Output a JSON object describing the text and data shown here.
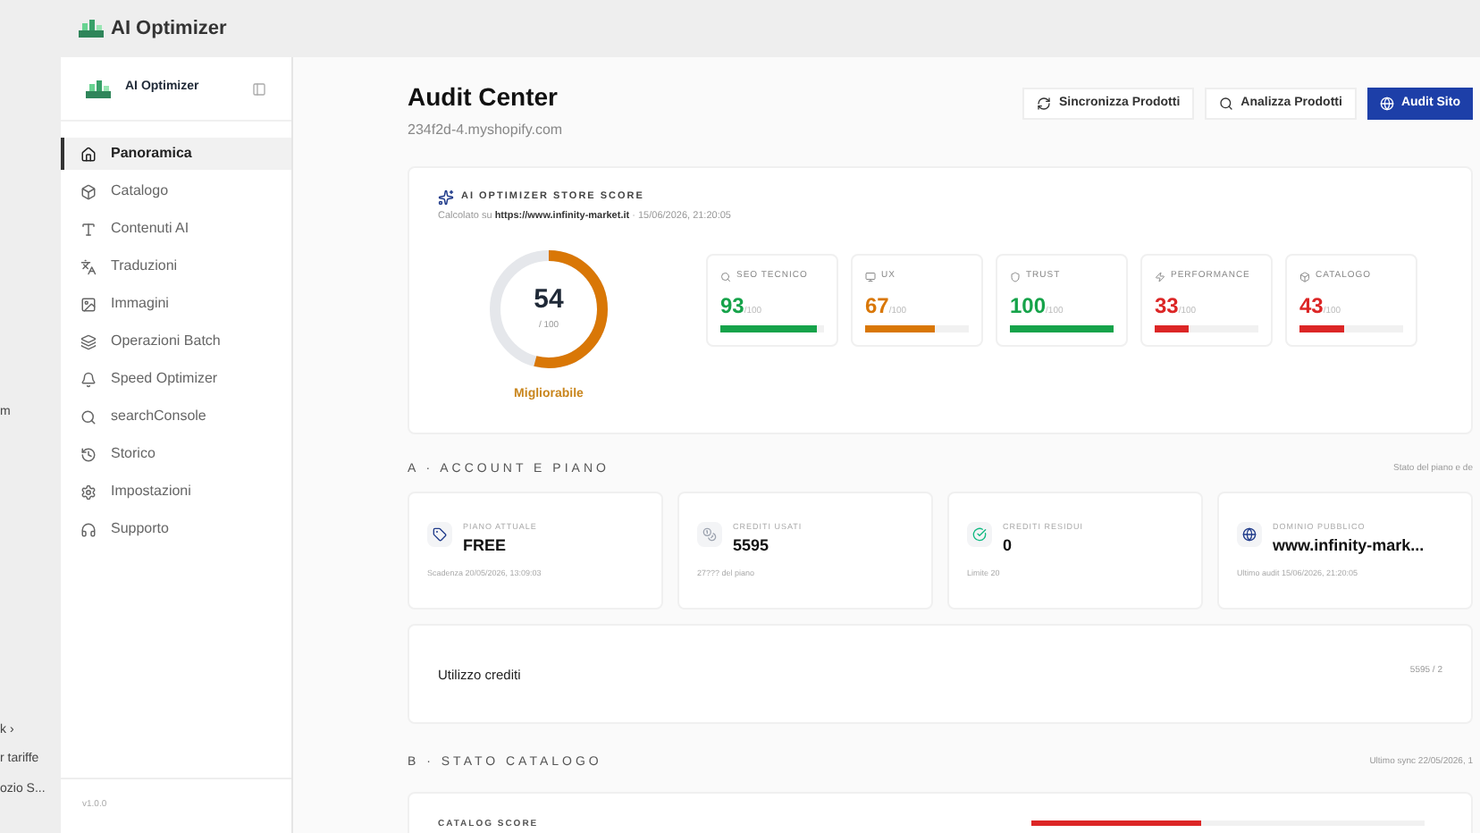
{
  "background_fragments": [
    "m",
    "k ›",
    "r tariffe",
    "ozio S..."
  ],
  "app_bar": {
    "title": "AI Optimizer"
  },
  "sidebar": {
    "brand": "AI Optimizer",
    "items": [
      {
        "label": "Panoramica",
        "selected": true
      },
      {
        "label": "Catalogo",
        "selected": false
      },
      {
        "label": "Contenuti AI",
        "selected": false
      },
      {
        "label": "Traduzioni",
        "selected": false
      },
      {
        "label": "Immagini",
        "selected": false
      },
      {
        "label": "Operazioni Batch",
        "selected": false
      },
      {
        "label": "Speed Optimizer",
        "selected": false
      },
      {
        "label": "searchConsole",
        "selected": false
      },
      {
        "label": "Storico",
        "selected": false
      },
      {
        "label": "Impostazioni",
        "selected": false
      },
      {
        "label": "Supporto",
        "selected": false
      }
    ],
    "version": "v1.0.0"
  },
  "header": {
    "title": "Audit Center",
    "subtitle": "234f2d-4.myshopify.com",
    "buttons": [
      {
        "label": "Sincronizza Prodotti",
        "primary": false
      },
      {
        "label": "Analizza Prodotti",
        "primary": false
      },
      {
        "label": "Audit Sito",
        "primary": true
      }
    ]
  },
  "score_card": {
    "title": "AI OPTIMIZER STORE SCORE",
    "calc_prefix": "Calcolato su",
    "calc_url": "https://www.infinity-market.it",
    "calc_date": "· 15/06/2026, 21:20:05",
    "score": "54",
    "max": "/ 100",
    "level": 0.54,
    "verdict": "Migliorabile",
    "metrics": [
      {
        "label": "SEO TECNICO",
        "value": "93",
        "max": "/100",
        "level": 0.93,
        "color": "#16a34a"
      },
      {
        "label": "UX",
        "value": "67",
        "max": "/100",
        "level": 0.67,
        "color": "#d97706"
      },
      {
        "label": "TRUST",
        "value": "100",
        "max": "/100",
        "level": 1,
        "color": "#16a34a"
      },
      {
        "label": "PERFORMANCE",
        "value": "33",
        "max": "/100",
        "level": 0.33,
        "color": "#dc2626"
      },
      {
        "label": "CATALOGO",
        "value": "43",
        "max": "/100",
        "level": 0.43,
        "color": "#dc2626"
      }
    ]
  },
  "section_a": {
    "title": "A · ACCOUNT E PIANO",
    "note": "Stato del piano e de",
    "cards": [
      {
        "label": "PIANO ATTUALE",
        "value": "FREE",
        "sub": "Scadenza 20/05/2026, 13:09:03"
      },
      {
        "label": "CREDITI USATI",
        "value": "5595",
        "sub": "27??? del piano"
      },
      {
        "label": "CREDITI RESIDUI",
        "value": "0",
        "sub": "Limite 20"
      },
      {
        "label": "DOMINIO PUBBLICO",
        "value": "www.infinity-mark...",
        "sub": "Ultimo audit 15/06/2026, 21:20:05"
      }
    ],
    "usage": {
      "label": "Utilizzo crediti",
      "reading": "5595 / 2"
    }
  },
  "section_b": {
    "title": "B · STATO CATALOGO",
    "note": "Ultimo sync 22/05/2026, 1",
    "score_label": "CATALOG SCORE",
    "level": 0.43
  }
}
